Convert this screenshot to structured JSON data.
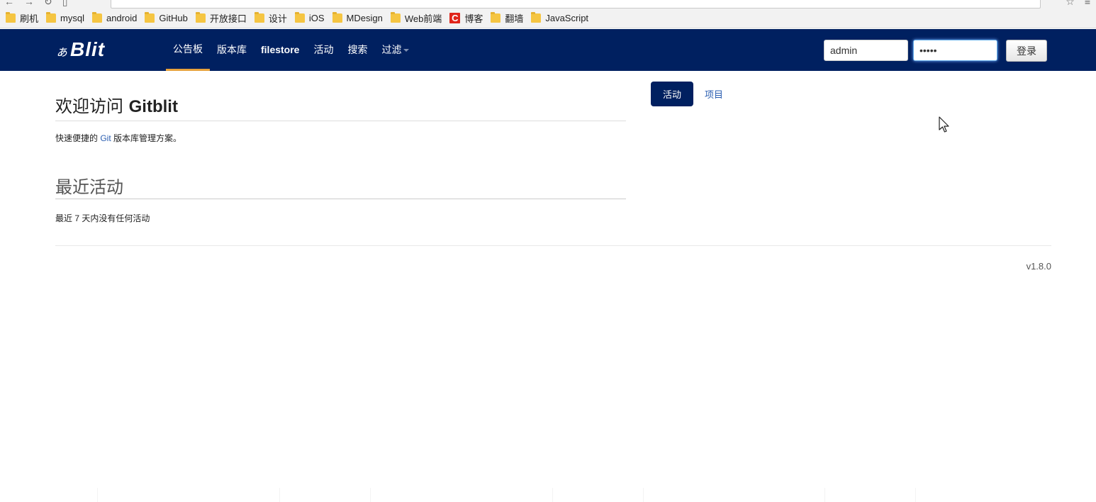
{
  "bookmarks": [
    {
      "label": "刷机",
      "icon": "folder-icon"
    },
    {
      "label": "mysql",
      "icon": "folder-icon"
    },
    {
      "label": "android",
      "icon": "folder-icon"
    },
    {
      "label": "GitHub",
      "icon": "folder-icon"
    },
    {
      "label": "开放接口",
      "icon": "folder-icon"
    },
    {
      "label": "设计",
      "icon": "folder-icon"
    },
    {
      "label": "iOS",
      "icon": "folder-icon"
    },
    {
      "label": "MDesign",
      "icon": "folder-icon"
    },
    {
      "label": "Web前端",
      "icon": "folder-icon"
    },
    {
      "label": "博客",
      "icon": "csdn-icon"
    },
    {
      "label": "翻墙",
      "icon": "folder-icon"
    },
    {
      "label": "JavaScript",
      "icon": "folder-icon"
    }
  ],
  "navbar": {
    "brand_prefix": "ぁ",
    "brand_text": "Blit",
    "links": [
      {
        "label": "公告板",
        "active": true
      },
      {
        "label": "版本库",
        "active": false
      },
      {
        "label": "filestore",
        "active": false
      },
      {
        "label": "活动",
        "active": false
      },
      {
        "label": "搜索",
        "active": false
      },
      {
        "label": "过滤",
        "active": false
      }
    ],
    "username_value": "admin",
    "password_value": "admin",
    "login_label": "登录"
  },
  "main": {
    "title_prefix": "欢迎访问 ",
    "title_app": "Gitblit",
    "tagline_before": "快速便捷的 ",
    "tagline_link": "Git",
    "tagline_after": " 版本库管理方案。",
    "section_title": "最近活动",
    "no_activity": "最近 7 天内没有任何活动"
  },
  "side_tabs": {
    "active": "活动",
    "inactive": "项目"
  },
  "footer": {
    "version": "v1.8.0"
  },
  "colors": {
    "navbar_bg": "#002060",
    "active_underline": "#e8a33d",
    "link": "#2a5db0"
  }
}
